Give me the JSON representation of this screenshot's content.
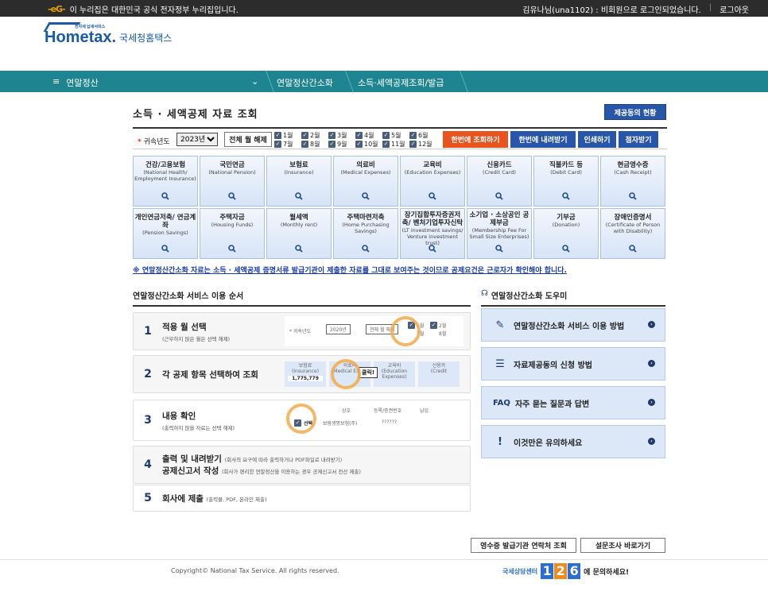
{
  "topbar": {
    "egov_mark": "-eG-",
    "gov_notice": "이 누리집은 대한민국 공식 전자정부 누리집입니다.",
    "user_status": "김유나님(una1102) : 비회원으로 로그인되었습니다.",
    "logout": "로그아웃"
  },
  "logo": {
    "mark": "Hometax.",
    "small": "전자세 납세서비스",
    "name": "국세청홈택스"
  },
  "navbar": {
    "menu_icon": "≡",
    "menu_label": "연말정산",
    "crumbs": [
      "연말정산간소화",
      "소득·세액공제조회/발급"
    ]
  },
  "page_title": "소득 · 세액공제 자료 조회",
  "provider_status_button": "제공동의 현황",
  "filter": {
    "year_label": "귀속년도",
    "required_mark": "*",
    "year_value": "2023년",
    "clear_all": "전체 월 해제",
    "months": [
      "1월",
      "2월",
      "3월",
      "4월",
      "5월",
      "6월",
      "7월",
      "8월",
      "9월",
      "10월",
      "11월",
      "12월"
    ],
    "btn_view_all": "한번에 조회하기",
    "btn_download_all": "한번에 내려받기",
    "btn_print": "인쇄하기",
    "btn_braille": "점자받기"
  },
  "categories": [
    {
      "k": "건강/고용보험",
      "e": "(National Health/ Employment Insurance)"
    },
    {
      "k": "국민연금",
      "e": "(National Pension)"
    },
    {
      "k": "보험료",
      "e": "(Insurance)"
    },
    {
      "k": "의료비",
      "e": "(Medical Expenses)"
    },
    {
      "k": "교육비",
      "e": "(Education Expenses)"
    },
    {
      "k": "신용카드",
      "e": "(Credit Card)"
    },
    {
      "k": "직불카드 등",
      "e": "(Debit Card)"
    },
    {
      "k": "현금영수증",
      "e": "(Cash Receipt)"
    },
    {
      "k": "개인연금저축/ 연금계좌",
      "e": "(Pension Savings)"
    },
    {
      "k": "주택자금",
      "e": "(Housing Funds)"
    },
    {
      "k": "월세액",
      "e": "(Monthly rent)"
    },
    {
      "k": "주택마련저축",
      "e": "(Home Purchasing Savings)"
    },
    {
      "k": "장기집합투자증권저축/ 벤처기업투자신탁",
      "e": "(LT investment savings/ Venture investment trust)"
    },
    {
      "k": "소기업 · 소상공인 공제부금",
      "e": "(Membership Fee For Small Size Enterprises)"
    },
    {
      "k": "기부금",
      "e": "(Donation)"
    },
    {
      "k": "장애인증명서",
      "e": "(Certificate of Person with Disability)"
    }
  ],
  "notice": "※ 연말정산간소화 자료는 소득 · 세액공제 증명서류 발급기관이 제출한 자료를 그대로 보여주는 것이므로 공제요건은 근로자가 확인해야 합니다.",
  "service_order_title": "연말정산간소화 서비스 이용 순서",
  "steps": [
    {
      "num": "1",
      "title": "적용 월 선택",
      "sub": "(근무하지 않은 월은 선택 해제)"
    },
    {
      "num": "2",
      "title": "각 공제 항목 선택하여 조회",
      "sub": ""
    },
    {
      "num": "3",
      "title": "내용 확인",
      "sub": "(출력하지 않을 자료는 선택 해제)"
    },
    {
      "num": "4",
      "title": "출력 및 내려받기",
      "inline1": "(회사의 요구에 따라 출력하거나 PDF파일로 내려받기)",
      "title2": "공제신고서 작성",
      "inline2": "(회사가 편리한 연말정산을 이용하는 경우 공제신고서 전산 제출)"
    },
    {
      "num": "5",
      "title": "회사에 제출",
      "inline1": "(출력물, PDF, 온라인 제출)"
    }
  ],
  "illus1": {
    "year_label": "* 귀속년도",
    "year": "2020년",
    "clear": "전체 월 해제",
    "m1": "1월",
    "m7": "7월",
    "m2": "2월",
    "m8": "8월"
  },
  "illus2": {
    "c1k": "보험료",
    "c1e": "(Insurance)",
    "c2k": "의료비",
    "c2e": "(Medical Expen",
    "c3k": "교육비",
    "c3e": "(Education Expenses)",
    "c4k": "신용카",
    "c4e": "(Credit",
    "amount": "1,775,779",
    "click": "클릭!"
  },
  "illus3": {
    "h1": "상호",
    "h2": "등록/증권번호",
    "h3": "납입",
    "row1": "보람생명보험(주)",
    "row1v": "??????",
    "sel": "선택"
  },
  "helper_title": "연말정산간소화 도우미",
  "helpers": [
    {
      "label": "연말정산간소화 서비스 이용 방법",
      "icon": "guide-icon"
    },
    {
      "label": "자료제공동의 신청 방법",
      "icon": "document-icon"
    },
    {
      "label": "자주 묻는 질문과 답변",
      "prefix": "FAQ",
      "icon": "faq-icon"
    },
    {
      "label": "이것만은 유의하세요",
      "icon": "warning-icon"
    }
  ],
  "bottom_buttons": {
    "issuer_contacts": "영수증 발급기관 연락처 조회",
    "survey": "설문조사 바로가기"
  },
  "footer": {
    "copyright": "Copyright© National Tax Service. All rights reserved.",
    "call_prefix": "국세상담센터",
    "number": [
      "1",
      "2",
      "6"
    ],
    "call_suffix": "에 문의하세요!"
  },
  "colors": {
    "teal_nav": "#1e8590",
    "blue_button": "#2856a8",
    "orange_button": "#e8531e",
    "category_bg": "#dce8f8"
  }
}
